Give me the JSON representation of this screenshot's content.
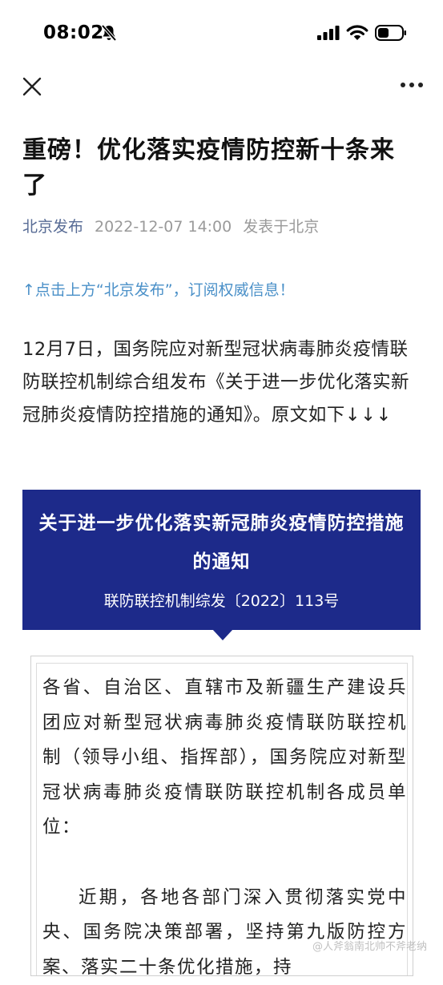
{
  "status_bar": {
    "time": "08:02"
  },
  "article": {
    "title": "重磅！优化落实疫情防控新十条来了",
    "account_name": "北京发布",
    "publish_time": "2022-12-07 14:00",
    "publish_location": "发表于北京",
    "subscribe_hint": "↑点击上方“北京发布”，订阅权威信息！",
    "intro": "12月7日，国务院应对新型冠状病毒肺炎疫情联防联控机制综合组发布《关于进一步优化落实新冠肺炎疫情防控措施的通知》。原文如下↓↓↓"
  },
  "document": {
    "title": "关于进一步优化落实新冠肺炎疫情防控措施的通知",
    "number": "联防联控机制综发〔2022〕113号",
    "addressee": "各省、自治区、直辖市及新疆生产建设兵团应对新型冠状病毒肺炎疫情联防联控机制（领导小组、指挥部），国务院应对新型冠状病毒肺炎疫情联防联控机制各成员单位：",
    "paragraph2": "近期，各地各部门深入贯彻落实党中央、国务院决策部署，坚持第九版防控方案、落实二十条优化措施，持"
  },
  "watermark": "@人斧翁南北帅不斧老纳"
}
